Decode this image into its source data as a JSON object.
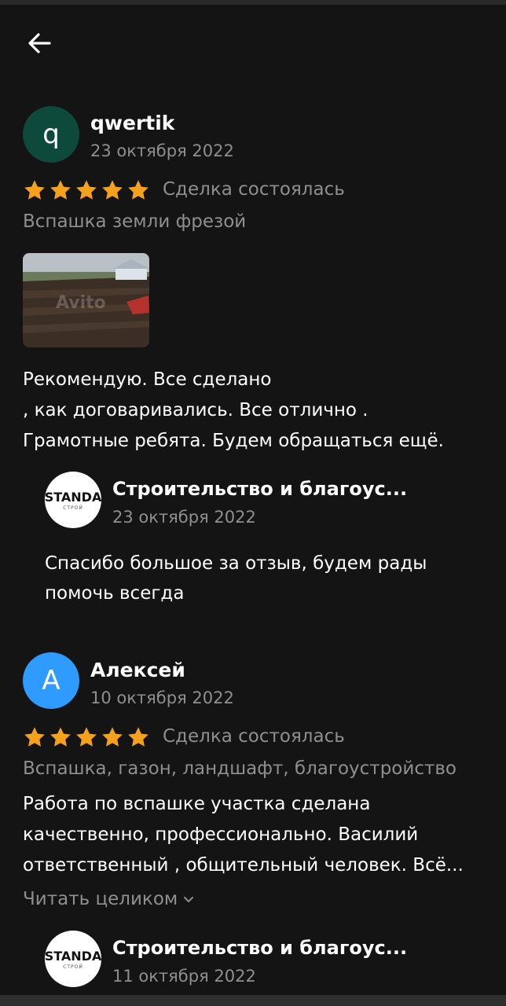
{
  "app": {
    "accent_star_color": "#f4a11d"
  },
  "reviews": [
    {
      "author_initial": "q",
      "avatar_color": "#0d4a3c",
      "author": "qwertik",
      "date": "23 октября 2022",
      "rating": 5,
      "status": "Сделка состоялась",
      "service": "Вспашка земли фрезой",
      "text_lines": [
        "Рекомендую. Все сделано",
        ", как договаривались. Все отлично .",
        "Грамотные ребята. Будем обращаться ещё."
      ],
      "photo_watermark": "Avito",
      "reply": {
        "logo_text": "STANDA",
        "logo_sub": "СТРОЙ",
        "author": "Строительство и благоус...",
        "date": "23 октября 2022",
        "text_lines": [
          "Спасибо большое за отзыв, будем рады",
          "помочь всегда"
        ]
      }
    },
    {
      "author_initial": "А",
      "avatar_color": "#2f9bff",
      "author": "Алексей",
      "date": "10 октября 2022",
      "rating": 5,
      "status": "Сделка состоялась",
      "service": "Вспашка, газон, ландшафт, благоустройство",
      "text_lines": [
        "Работа по вспашке участка сделана",
        "качественно, профессионально.  Василий",
        "ответственный , общительный человек. Всё..."
      ],
      "read_more": "Читать целиком",
      "reply": {
        "logo_text": "STANDA",
        "logo_sub": "СТРОЙ",
        "author": "Строительство и благоус...",
        "date": "11 октября 2022"
      }
    }
  ]
}
